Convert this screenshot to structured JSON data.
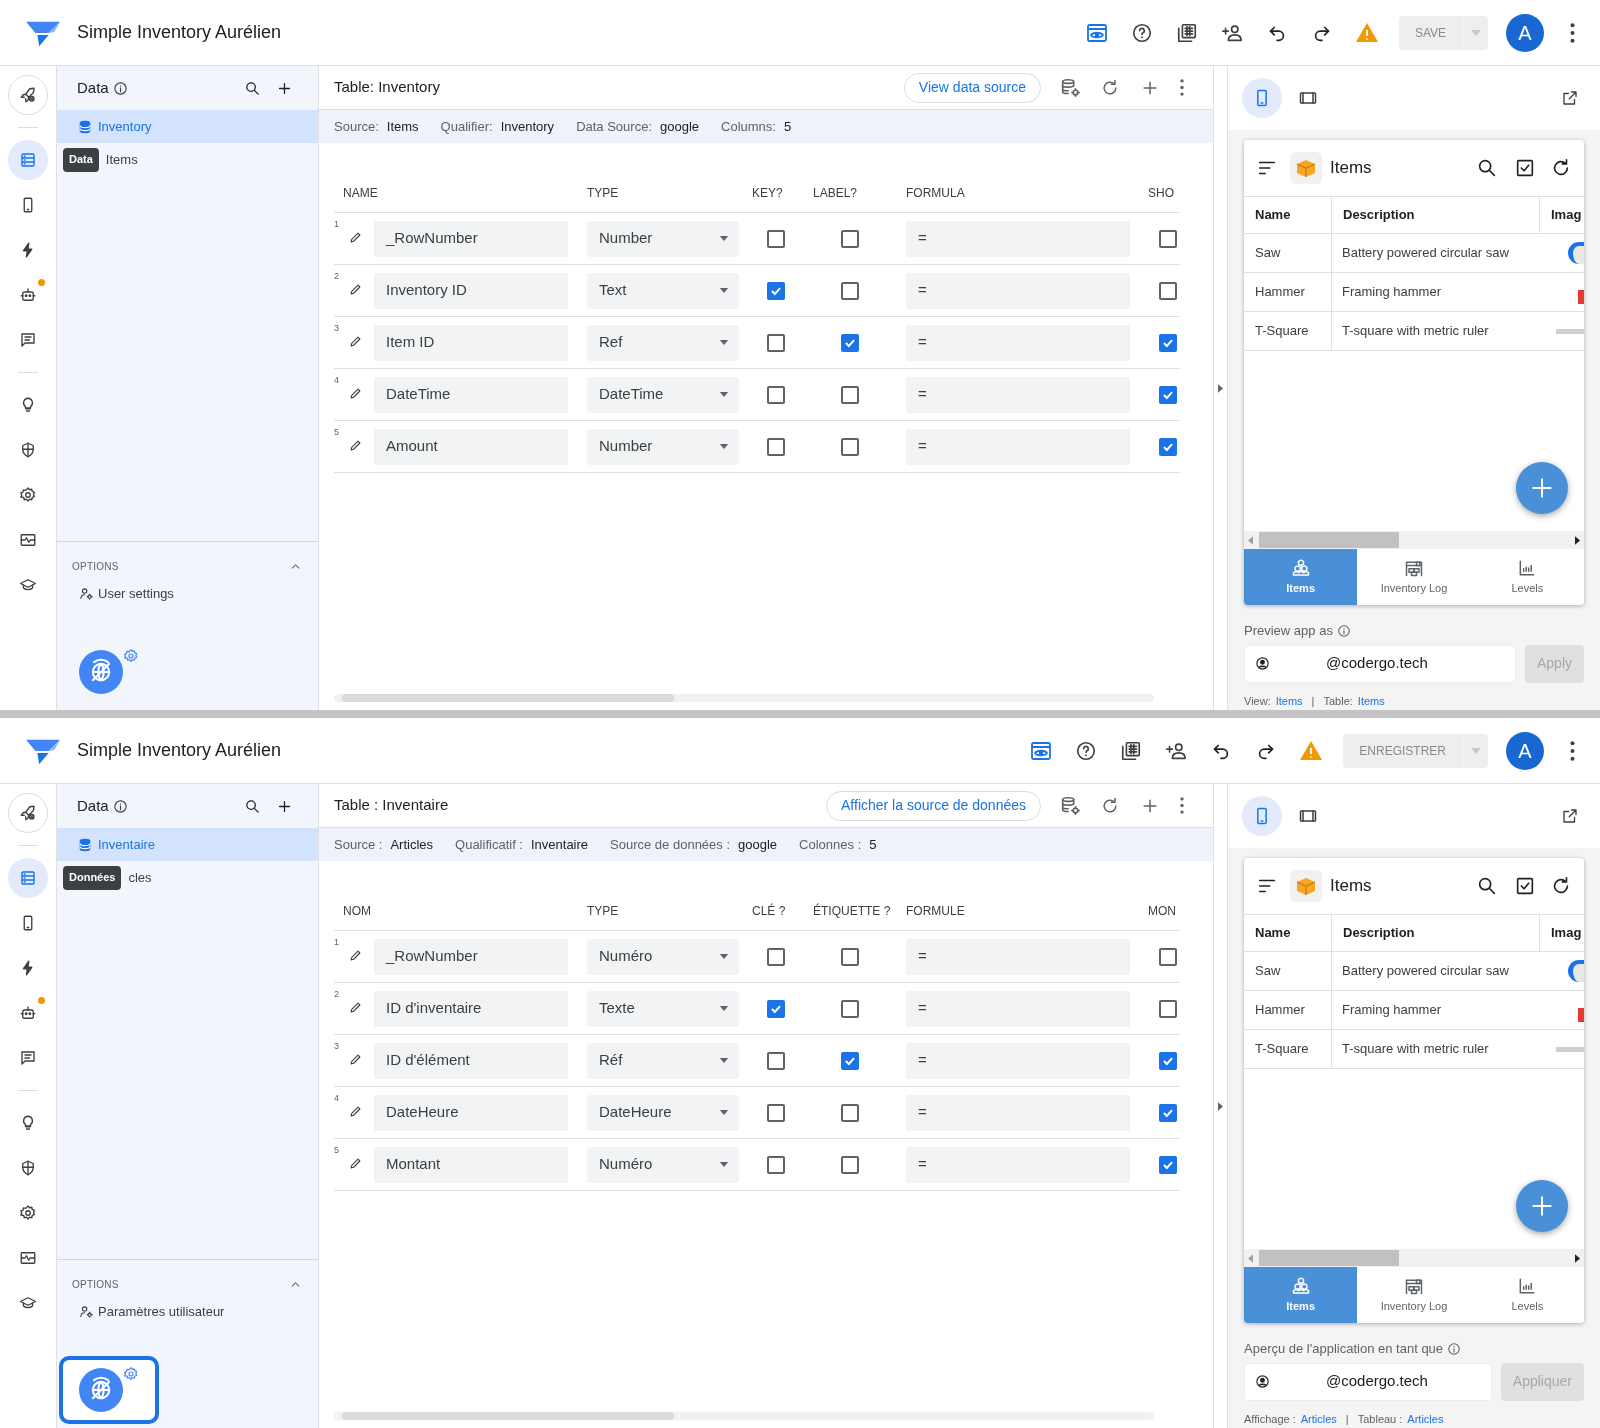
{
  "screens": [
    {
      "app_title": "Simple Inventory Aurélien",
      "save_label": "SAVE",
      "avatar": "A",
      "rail_groups": [
        [
          {
            "kind": "rocket",
            "selected": false,
            "alert": false
          }
        ],
        [
          {
            "kind": "data",
            "selected": true,
            "alert": false
          },
          {
            "kind": "phone",
            "selected": false,
            "alert": false
          },
          {
            "kind": "bolt",
            "selected": false,
            "alert": false
          },
          {
            "kind": "robot",
            "selected": false,
            "alert": true
          },
          {
            "kind": "chat",
            "selected": false,
            "alert": false
          }
        ],
        [
          {
            "kind": "bulb",
            "selected": false,
            "alert": false
          },
          {
            "kind": "shield",
            "selected": false,
            "alert": false
          },
          {
            "kind": "gear",
            "selected": false,
            "alert": false
          },
          {
            "kind": "monitor",
            "selected": false,
            "alert": false
          },
          {
            "kind": "cap",
            "selected": false,
            "alert": false
          }
        ]
      ],
      "data_panel": {
        "title": "Data",
        "tables": [
          {
            "label": "Inventory",
            "selected": true
          },
          {
            "label": "Items",
            "selected": false,
            "tooltip": "Data"
          }
        ],
        "options_title": "OPTIONS",
        "options_expanded": true,
        "options_items": [
          "User settings"
        ],
        "assistant_focused": false
      },
      "table_editor": {
        "title": "Table: Inventory",
        "view_source": "View data source",
        "meta": [
          {
            "label": "Source:",
            "value": "Items"
          },
          {
            "label": "Qualifier:",
            "value": "Inventory"
          },
          {
            "label": "Data Source:",
            "value": "google"
          },
          {
            "label": "Columns:",
            "value": "5"
          }
        ],
        "columns": [
          "NAME",
          "TYPE",
          "KEY?",
          "LABEL?",
          "FORMULA",
          "SHO"
        ],
        "rows": [
          {
            "number": "1",
            "name": "_RowNumber",
            "type": "Number",
            "key": false,
            "label": false,
            "formula": "=",
            "show": false
          },
          {
            "number": "2",
            "name": "Inventory ID",
            "type": "Text",
            "key": true,
            "label": false,
            "formula": "=",
            "show": false
          },
          {
            "number": "3",
            "name": "Item ID",
            "type": "Ref",
            "key": false,
            "label": true,
            "formula": "=",
            "show": true
          },
          {
            "number": "4",
            "name": "DateTime",
            "type": "DateTime",
            "key": false,
            "label": false,
            "formula": "=",
            "show": true
          },
          {
            "number": "5",
            "name": "Amount",
            "type": "Number",
            "key": false,
            "label": false,
            "formula": "=",
            "show": true
          }
        ]
      },
      "preview": {
        "title": "Items",
        "columns": [
          "Name",
          "Description",
          "Imag"
        ],
        "rows": [
          {
            "name": "Saw",
            "description": "Battery powered circular saw"
          },
          {
            "name": "Hammer",
            "description": "Framing hammer"
          },
          {
            "name": "T-Square",
            "description": "T-square with metric ruler"
          }
        ],
        "nav": [
          {
            "label": "Items",
            "kind": "cubes",
            "selected": true
          },
          {
            "label": "Inventory Log",
            "kind": "warehouse",
            "selected": false
          },
          {
            "label": "Levels",
            "kind": "chart",
            "selected": false
          }
        ],
        "preview_as": "Preview app as",
        "email": "@codergo.tech",
        "apply": "Apply",
        "separator": "|",
        "footer": [
          {
            "label": "View:",
            "value": "Items"
          },
          {
            "label": "Table:",
            "value": "Items"
          }
        ]
      }
    },
    {
      "app_title": "Simple Inventory Aurélien",
      "save_label": "ENREGISTRER",
      "avatar": "A",
      "rail_groups": [
        [
          {
            "kind": "rocket",
            "selected": false,
            "alert": false
          }
        ],
        [
          {
            "kind": "data",
            "selected": true,
            "alert": false
          },
          {
            "kind": "phone",
            "selected": false,
            "alert": false
          },
          {
            "kind": "bolt",
            "selected": false,
            "alert": false
          },
          {
            "kind": "robot",
            "selected": false,
            "alert": true
          },
          {
            "kind": "chat",
            "selected": false,
            "alert": false
          }
        ],
        [
          {
            "kind": "bulb",
            "selected": false,
            "alert": false
          },
          {
            "kind": "shield",
            "selected": false,
            "alert": false
          },
          {
            "kind": "gear",
            "selected": false,
            "alert": false
          },
          {
            "kind": "monitor",
            "selected": false,
            "alert": false
          },
          {
            "kind": "cap",
            "selected": false,
            "alert": false
          }
        ]
      ],
      "data_panel": {
        "title": "Data",
        "tables": [
          {
            "label": "Inventaire",
            "selected": true
          },
          {
            "label": "cles",
            "selected": false,
            "tooltip": "Données"
          }
        ],
        "options_title": "OPTIONS",
        "options_expanded": true,
        "options_items": [
          "Paramètres utilisateur"
        ],
        "assistant_focused": true
      },
      "table_editor": {
        "title": "Table : Inventaire",
        "view_source": "Afficher la source de données",
        "meta": [
          {
            "label": "Source :",
            "value": "Articles"
          },
          {
            "label": "Qualificatif :",
            "value": "Inventaire"
          },
          {
            "label": "Source de données :",
            "value": "google"
          },
          {
            "label": "Colonnes :",
            "value": "5"
          }
        ],
        "columns": [
          "NOM",
          "TYPE",
          "CLÉ ?",
          "ÉTIQUETTE ?",
          "FORMULE",
          "MON"
        ],
        "rows": [
          {
            "number": "1",
            "name": "_RowNumber",
            "type": "Numéro",
            "key": false,
            "label": false,
            "formula": "=",
            "show": false
          },
          {
            "number": "2",
            "name": "ID d'inventaire",
            "type": "Texte",
            "key": true,
            "label": false,
            "formula": "=",
            "show": false
          },
          {
            "number": "3",
            "name": "ID d'élément",
            "type": "Réf",
            "key": false,
            "label": true,
            "formula": "=",
            "show": true
          },
          {
            "number": "4",
            "name": "DateHeure",
            "type": "DateHeure",
            "key": false,
            "label": false,
            "formula": "=",
            "show": true
          },
          {
            "number": "5",
            "name": "Montant",
            "type": "Numéro",
            "key": false,
            "label": false,
            "formula": "=",
            "show": true
          }
        ]
      },
      "preview": {
        "title": "Items",
        "columns": [
          "Name",
          "Description",
          "Imag"
        ],
        "rows": [
          {
            "name": "Saw",
            "description": "Battery powered circular saw"
          },
          {
            "name": "Hammer",
            "description": "Framing hammer"
          },
          {
            "name": "T-Square",
            "description": "T-square with metric ruler"
          }
        ],
        "nav": [
          {
            "label": "Items",
            "kind": "cubes",
            "selected": true
          },
          {
            "label": "Inventory Log",
            "kind": "warehouse",
            "selected": false
          },
          {
            "label": "Levels",
            "kind": "chart",
            "selected": false
          }
        ],
        "preview_as": "Aperçu de l'application en tant que",
        "email": "@codergo.tech",
        "apply": "Appliquer",
        "separator": "|",
        "footer": [
          {
            "label": "Affichage :",
            "value": "Articles"
          },
          {
            "label": "Tableau :",
            "value": "Articles"
          }
        ]
      }
    }
  ]
}
